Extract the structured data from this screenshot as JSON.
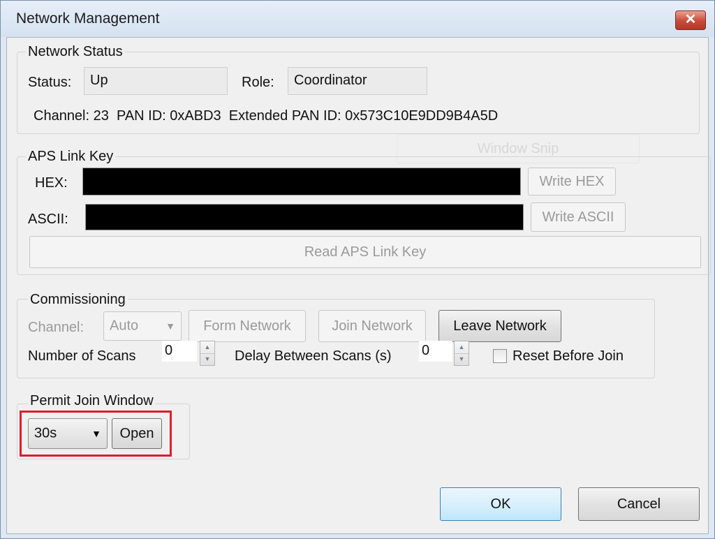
{
  "window": {
    "title": "Network Management",
    "close_glyph": "✕",
    "close_icon": "close-icon",
    "close_color": "#c94a38"
  },
  "network_status": {
    "legend": "Network Status",
    "status_label": "Status:",
    "status_value": "Up",
    "role_label": "Role:",
    "role_value": "Coordinator",
    "info_line": "Channel: 23  PAN ID: 0xABD3  Extended PAN ID: 0x573C10E9DD9B4A5D"
  },
  "overlay": {
    "ghost_label": "Window Snip"
  },
  "aps_link_key": {
    "legend": "APS Link Key",
    "hex_label": "HEX:",
    "ascii_label": "ASCII:",
    "write_hex_label": "Write HEX",
    "write_ascii_label": "Write ASCII",
    "read_label": "Read APS Link Key"
  },
  "commissioning": {
    "legend": "Commissioning",
    "channel_label": "Channel:",
    "channel_value": "Auto",
    "form_label": "Form Network",
    "join_label": "Join Network",
    "leave_label": "Leave Network",
    "scans_label": "Number of Scans",
    "scans_value": "0",
    "delay_label": "Delay Between Scans (s)",
    "delay_value": "0",
    "reset_label": "Reset Before Join",
    "reset_checked": false
  },
  "permit_join": {
    "legend": "Permit Join Window",
    "duration_value": "30s",
    "open_label": "Open",
    "highlight_color": "#e01c2d"
  },
  "footer": {
    "ok_label": "OK",
    "cancel_label": "Cancel"
  }
}
